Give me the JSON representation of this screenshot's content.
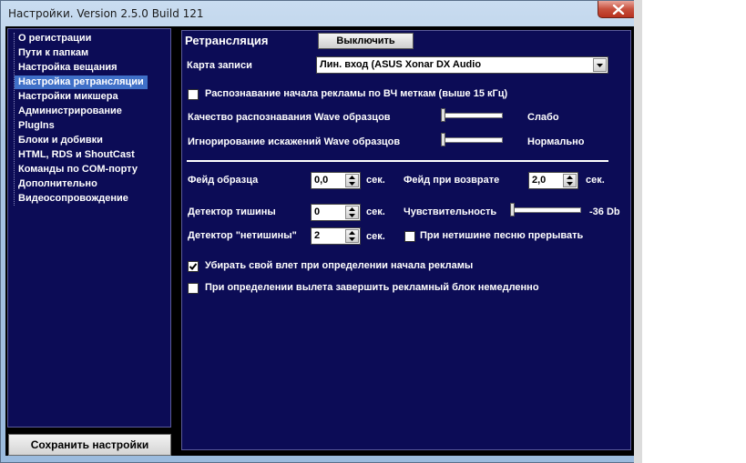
{
  "window": {
    "title": "Настройки. Version 2.5.0 Build 121"
  },
  "sidebar": {
    "items": [
      {
        "label": "О регистрации",
        "active": false
      },
      {
        "label": "Пути к папкам",
        "active": false
      },
      {
        "label": "Настройка вещания",
        "active": false
      },
      {
        "label": "Настройка ретрансляции",
        "active": true
      },
      {
        "label": "Настройки микшера",
        "active": false
      },
      {
        "label": "Администрирование",
        "active": false
      },
      {
        "label": "PlugIns",
        "active": false
      },
      {
        "label": "Блоки и добивки",
        "active": false
      },
      {
        "label": "HTML, RDS и ShoutCast",
        "active": false
      },
      {
        "label": "Команды по COM-порту",
        "active": false
      },
      {
        "label": "Дополнительно",
        "active": false
      },
      {
        "label": "Видеосопровождение",
        "active": false
      }
    ],
    "save_label": "Сохранить настройки"
  },
  "panel": {
    "title": "Ретрансляция",
    "off_button": "Выключить",
    "capture_card_label": "Карта записи",
    "capture_card_value": "Лин. вход (ASUS Xonar DX Audio",
    "ad_detect_label": "Распознавание начала рекламы по ВЧ меткам (выше 15 кГц)",
    "ad_detect_checked": false,
    "wave_quality_label": "Качество распознавания Wave образцов",
    "wave_quality_value_text": "Слабо",
    "wave_quality_level": 0.0,
    "wave_ignore_label": "Игнорирование искажений Wave образцов",
    "wave_ignore_value_text": "Нормально",
    "wave_ignore_level": 0.0,
    "fade_sample_label": "Фейд образца",
    "fade_sample_value": "0,0",
    "fade_return_label": "Фейд при возврате",
    "fade_return_value": "2,0",
    "sec_unit": "сек.",
    "silence_detector_label": "Детектор тишины",
    "silence_detector_value": "0",
    "sensitivity_label": "Чувствительность",
    "sensitivity_value_text": "-36 Db",
    "sensitivity_level": 0.0,
    "non_silence_detector_label": "Детектор \"нетишины\"",
    "non_silence_detector_value": "2",
    "interrupt_song_label": "При нетишине песню прерывать",
    "interrupt_song_checked": false,
    "remove_jingle_label": "Убирать свой влет при определении начала рекламы",
    "remove_jingle_checked": true,
    "end_block_label": "При определении вылета завершить рекламный блок немедленно",
    "end_block_checked": false
  },
  "icons": {
    "close": "close-icon",
    "dropdown": "chevron-down-icon",
    "spin": "spin-arrows-icon",
    "check": "check-icon"
  },
  "colors": {
    "panel_bg": "#0c0c56",
    "active_item": "#3f70c8",
    "close_button": "#c7503d"
  }
}
